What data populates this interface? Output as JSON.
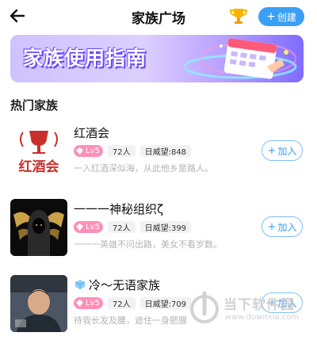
{
  "header": {
    "title": "家族广场",
    "create_label": "创建"
  },
  "banner": {
    "text": "家族使用指南"
  },
  "section": {
    "title": "热门家族"
  },
  "families": [
    {
      "name": "红酒会",
      "avatar_text": "红酒会",
      "level": "Lv5",
      "members": "72人",
      "prestige": "日威望:848",
      "desc": "一入红酒深似海，从此他乡是路人。",
      "join_label": "加入"
    },
    {
      "name": "一一一神秘组织ζ",
      "level": "Lv5",
      "members": "72人",
      "prestige": "日威望:399",
      "desc": "一一一英雄不问出路，美女不看岁数。",
      "join_label": "加入"
    },
    {
      "name": "冷～无语家族",
      "level": "Lv5",
      "members": "72人",
      "prestige": "日威望:709",
      "desc": "待我长发及腰，遮住一身肥膘",
      "join_label": "加入"
    }
  ],
  "watermark": {
    "title": "当下软件园",
    "url": "www.downxia.com"
  },
  "colors": {
    "accent": "#3aa0f5",
    "level_badge": "#ff8fb8",
    "banner_start": "#cfc2ff",
    "banner_end": "#7f6cff"
  }
}
